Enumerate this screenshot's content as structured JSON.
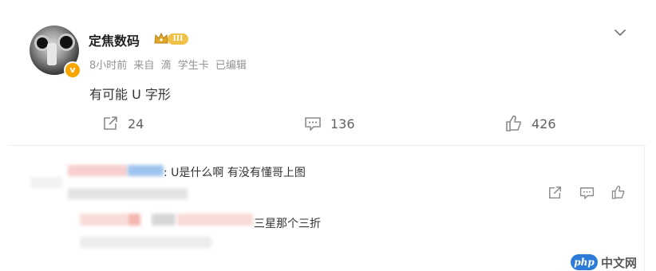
{
  "post": {
    "author": "定焦数码",
    "level_badge": "III",
    "verified_mark": "v",
    "meta": {
      "time": "8小时前",
      "source_prefix": "来自",
      "source_icon": "滴",
      "source": "学生卡",
      "edited": "已编辑"
    },
    "content": "有可能 U 字形",
    "actions": {
      "repost_count": "24",
      "comment_count": "136",
      "like_count": "426"
    }
  },
  "comments": [
    {
      "author_blurred": true,
      "text": ": U是什么啊 有没有懂哥上图"
    },
    {
      "author_blurred": true,
      "text": "三星那个三折"
    }
  ],
  "watermark": {
    "logo": "php",
    "text": "中文网"
  },
  "colors": {
    "level_badge": "#f0c24a",
    "verified_badge": "#f7a600",
    "icon_gray": "#8a8a8a",
    "watermark_blue": "#2d7bd8"
  },
  "icons": [
    "crown-icon",
    "chevron-down-icon",
    "repost-icon",
    "comment-icon",
    "like-icon"
  ]
}
